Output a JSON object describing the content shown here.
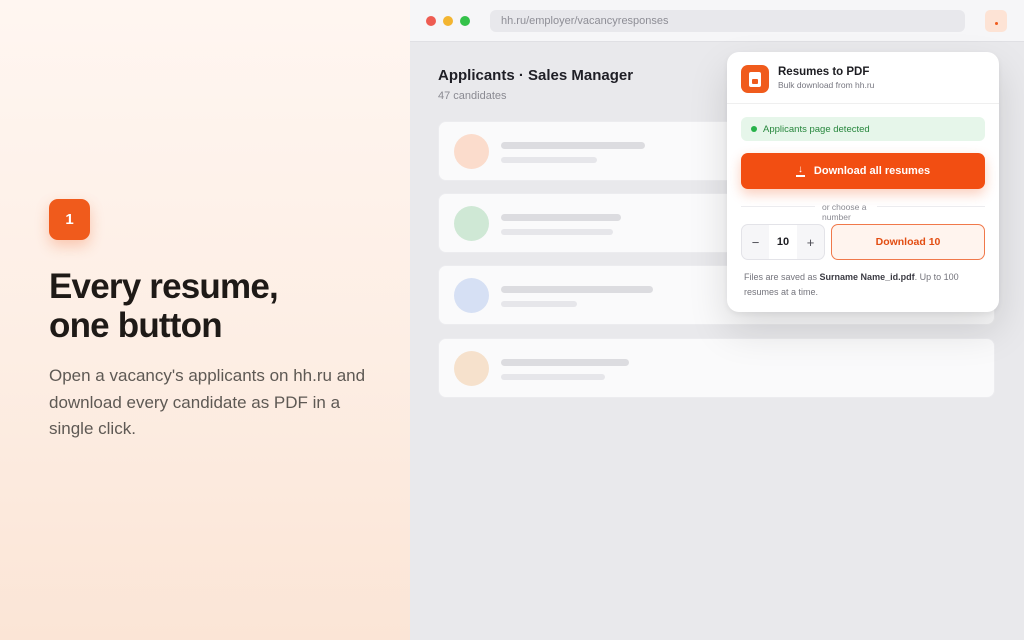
{
  "promo": {
    "step_number": "1",
    "headline_line1": "Every resume,",
    "headline_line2": "one button",
    "subtext": "Open a vacancy's applicants on hh.ru and download every candidate as PDF in a single click."
  },
  "browser": {
    "url": "hh.ru/employer/vacancyresponses",
    "page_title": "Applicants · Sales Manager",
    "candidate_count": "47 candidates",
    "cards": [
      {
        "avatar_color": "#fbdccc"
      },
      {
        "avatar_color": "#cfe8d5"
      },
      {
        "avatar_color": "#d6e0f4"
      },
      {
        "avatar_color": "#f6e1cc"
      }
    ]
  },
  "extension": {
    "title": "Resumes to PDF",
    "description": "Bulk download from hh.ru",
    "status": "Applicants page detected",
    "download_all_label": "Download all resumes",
    "or_choose": "or choose a number",
    "quantity": "10",
    "minus_glyph": "−",
    "plus_glyph": "+",
    "download_n_label": "Download 10",
    "note_prefix": "Files are saved as ",
    "note_filename": "Surname Name_id.pdf",
    "note_suffix": ". Up to 100 resumes at a time."
  },
  "colors": {
    "accent": "#f24e12",
    "success": "#27b24a"
  }
}
